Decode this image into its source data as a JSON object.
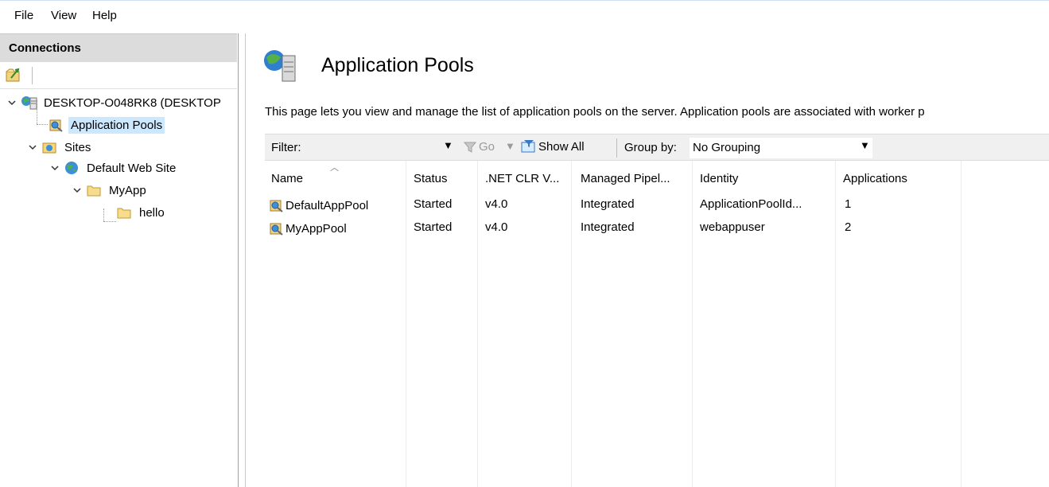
{
  "menu": {
    "file": "File",
    "view": "View",
    "help": "Help"
  },
  "connections": {
    "title": "Connections",
    "tree": {
      "server": "DESKTOP-O048RK8 (DESKTOP",
      "app_pools": "Application Pools",
      "sites": "Sites",
      "default_site": "Default Web Site",
      "myapp": "MyApp",
      "hello": "hello"
    }
  },
  "main": {
    "title": "Application Pools",
    "description": "This page lets you view and manage the list of application pools on the server. Application pools are associated with worker p",
    "filter": {
      "label": "Filter:",
      "value": "",
      "go_label": "Go",
      "show_all_label": "Show All",
      "group_by_label": "Group by:",
      "group_by_value": "No Grouping"
    },
    "columns": [
      "Name",
      "Status",
      ".NET CLR V...",
      "Managed Pipel...",
      "Identity",
      "Applications"
    ],
    "rows": [
      {
        "name": "DefaultAppPool",
        "status": "Started",
        "clr": "v4.0",
        "pipeline": "Integrated",
        "identity": "ApplicationPoolId...",
        "applications": "1"
      },
      {
        "name": "MyAppPool",
        "status": "Started",
        "clr": "v4.0",
        "pipeline": "Integrated",
        "identity": "webappuser",
        "applications": "2"
      }
    ]
  }
}
